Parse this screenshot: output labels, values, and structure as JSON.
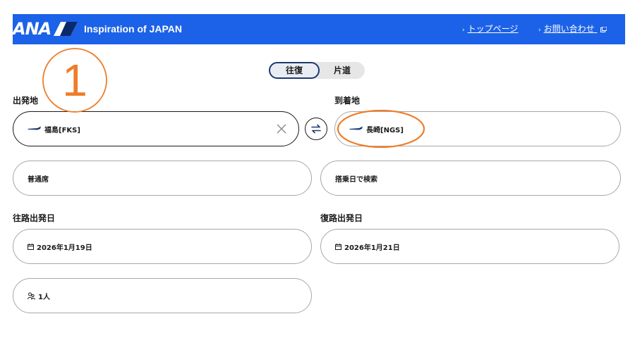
{
  "header": {
    "logo": "ANA",
    "tagline": "Inspiration of JAPAN",
    "links": [
      {
        "label": "トップページ"
      },
      {
        "label": "お問い合わせ"
      }
    ],
    "bg_color": "#1c62e8"
  },
  "trip_type": {
    "options": [
      "往復",
      "片道"
    ],
    "selected": "往復"
  },
  "departure": {
    "label": "出発地",
    "value": "福島[FKS]"
  },
  "arrival": {
    "label": "到着地",
    "value": "長崎[NGS]"
  },
  "cabin_class": {
    "value": "普通席"
  },
  "search_mode": {
    "value": "搭乗日で検索"
  },
  "outbound_date": {
    "label": "往路出発日",
    "value": "2026年1月19日"
  },
  "return_date": {
    "label": "復路出発日",
    "value": "2026年1月21日"
  },
  "passengers": {
    "value": "1人"
  },
  "annotation": {
    "step_number": "1",
    "color": "#ee7d2a"
  },
  "icons": [
    "ana-logo-icon",
    "external-link-icon",
    "plane-icon",
    "clear-icon",
    "swap-icon",
    "calendar-icon",
    "person-icon"
  ]
}
